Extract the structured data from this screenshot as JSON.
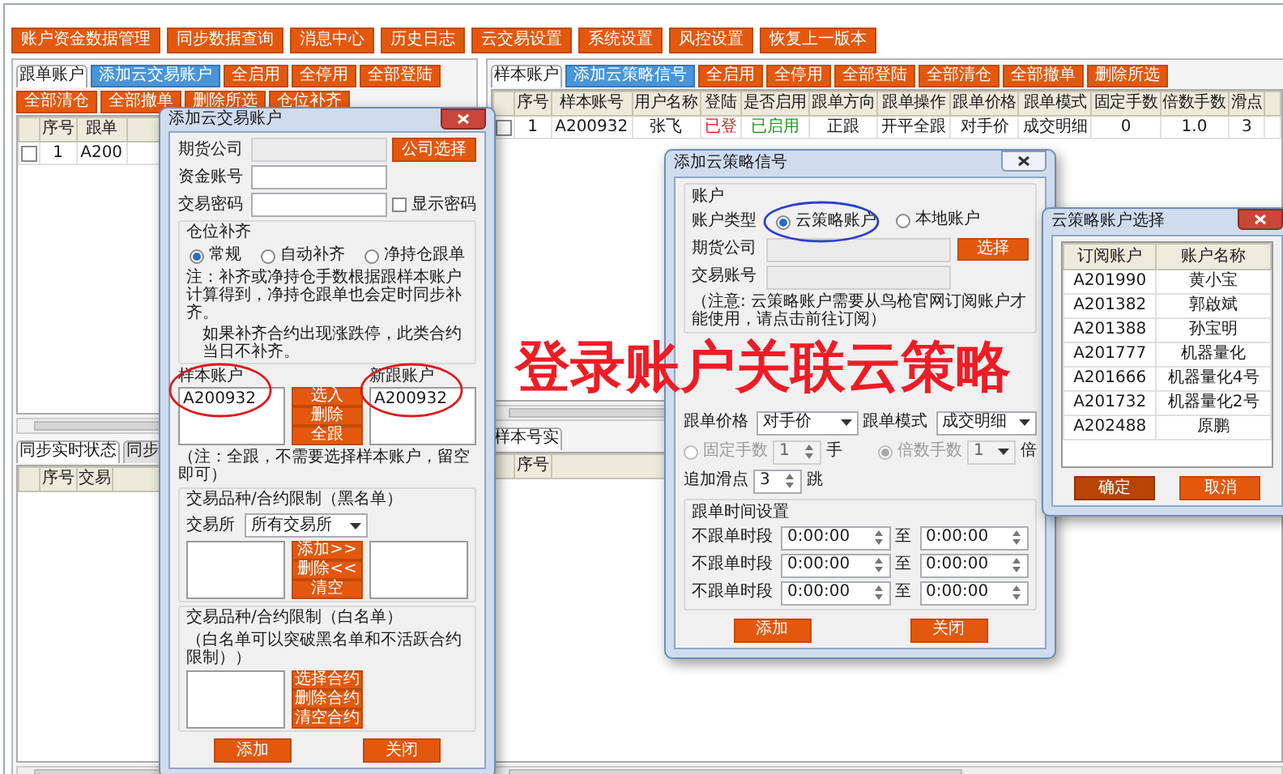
{
  "toolbar": {
    "buttons": [
      "账户资金数据管理",
      "同步数据查询",
      "消息中心",
      "历史日志",
      "云交易设置",
      "系统设置",
      "风控设置",
      "恢复上一版本"
    ]
  },
  "follow_pane": {
    "tabs": [
      {
        "label": "跟单账户",
        "selected": true
      }
    ],
    "actions": [
      {
        "label": "添加云交易账户",
        "kind": "primary"
      },
      {
        "label": "全启用",
        "kind": "action"
      },
      {
        "label": "全停用",
        "kind": "action"
      },
      {
        "label": "全部登陆",
        "kind": "action"
      },
      {
        "label": "全部清仓",
        "kind": "action"
      },
      {
        "label": "全部撤单",
        "kind": "action"
      },
      {
        "label": "删除所选",
        "kind": "action"
      },
      {
        "label": "仓位补齐",
        "kind": "action"
      }
    ],
    "table": {
      "columns": [
        "序号",
        "跟单"
      ],
      "rows": [
        {
          "checked": false,
          "cells": [
            "1",
            "A200"
          ]
        }
      ]
    },
    "bottom_tabs": [
      {
        "label": "同步实时状态",
        "selected": true
      },
      {
        "label": "同步",
        "selected": false
      }
    ],
    "bottom_table": {
      "columns": [
        "序号",
        "交易"
      ]
    }
  },
  "sample_pane": {
    "tabs": [
      {
        "label": "样本账户",
        "selected": true
      }
    ],
    "actions": [
      {
        "label": "添加云策略信号",
        "kind": "primary"
      },
      {
        "label": "全启用",
        "kind": "action"
      },
      {
        "label": "全停用",
        "kind": "action"
      },
      {
        "label": "全部登陆",
        "kind": "action"
      },
      {
        "label": "全部清仓",
        "kind": "action"
      },
      {
        "label": "全部撤单",
        "kind": "action"
      },
      {
        "label": "删除所选",
        "kind": "action"
      }
    ],
    "table": {
      "columns": [
        "序号",
        "样本账号",
        "用户名称",
        "登陆",
        "是否启用",
        "跟单方向",
        "跟单操作",
        "跟单价格",
        "跟单模式",
        "固定手数",
        "倍数手数",
        "滑点"
      ],
      "rows": [
        {
          "checked": false,
          "cells": [
            "1",
            "A200932",
            "张飞",
            {
              "text": "已登",
              "color": "#e02020"
            },
            {
              "text": "已启用",
              "color": "#1e9a1e"
            },
            "正跟",
            "开平全跟",
            "对手价",
            "成交明细",
            "0",
            "1.0",
            "3"
          ]
        }
      ]
    },
    "bottom_tabs": [
      {
        "label": "样本号实",
        "selected": true
      }
    ],
    "bottom_table": {
      "columns": [
        "序号"
      ]
    }
  },
  "account_dialog": {
    "title": "添加云交易账户",
    "fields": [
      {
        "label": "期货公司",
        "kind": "readonly"
      },
      {
        "label": "资金账号",
        "kind": "input"
      },
      {
        "label": "交易密码",
        "kind": "input"
      }
    ],
    "company_button": "公司选择",
    "show_password": {
      "label": "显示密码",
      "checked": false
    },
    "position_fill": {
      "title": "仓位补齐",
      "options": [
        {
          "label": "常规",
          "selected": true
        },
        {
          "label": "自动补齐",
          "selected": false
        },
        {
          "label": "净持仓跟单",
          "selected": false
        }
      ],
      "notes": [
        "注：补齐或净持仓手数根据跟样本账户计算得到，净持仓跟单也会定时同步补齐。",
        "如果补齐合约出现涨跌停，此类合约当日不补齐。"
      ]
    },
    "sample_list": {
      "title": "样本账户",
      "items": [
        "A200932"
      ],
      "circled": true
    },
    "list_buttons": [
      "选入",
      "删除",
      "全跟"
    ],
    "follow_list": {
      "title": "新跟账户",
      "items": [
        "A200932"
      ],
      "circled": true
    },
    "follow_note": "（注：全跟，不需要选择样本账户，留空即可）",
    "blacklist": {
      "title": "交易品种/合约限制（黑名单）",
      "exchange_label": "交易所",
      "exchange": "所有交易所",
      "buttons": [
        "添加>>",
        "删除<<",
        "清空"
      ]
    },
    "whitelist": {
      "title": "交易品种/合约限制（白名单）",
      "note": "（白名单可以突破黑名单和不活跃合约限制））",
      "buttons": [
        "选择合约",
        "删除合约",
        "清空合约"
      ]
    },
    "footer": [
      "添加",
      "关闭"
    ]
  },
  "signal_dialog": {
    "title": "添加云策略信号",
    "group": "账户",
    "account_type": {
      "label": "账户类型",
      "options": [
        {
          "label": "云策略账户",
          "selected": true,
          "circled": true
        },
        {
          "label": "本地账户",
          "selected": false,
          "circled": false
        }
      ]
    },
    "fields": [
      {
        "label": "期货公司",
        "button": "选择"
      },
      {
        "label": "交易账号"
      }
    ],
    "note": "（注意: 云策略账户需要从鸟枪官网订阅账户才能使用，请点击前往订阅）",
    "price": {
      "label": "跟单价格",
      "value": "对手价"
    },
    "mode": {
      "label": "跟单模式",
      "value": "成交明细"
    },
    "lots": [
      {
        "label": "固定手数",
        "selected": false,
        "disabled": true,
        "value": "1",
        "unit": "手",
        "kind": "spin"
      },
      {
        "label": "倍数手数",
        "selected": true,
        "disabled": true,
        "value": "1",
        "unit": "倍",
        "kind": "combo"
      }
    ],
    "slippage": {
      "label": "追加滑点",
      "value": "3",
      "unit": "跳"
    },
    "time_group": {
      "title": "跟单时间设置",
      "rows": [
        {
          "label": "不跟单时段",
          "from": "0:00:00",
          "sep": "至",
          "to": "0:00:00"
        },
        {
          "label": "不跟单时段",
          "from": "0:00:00",
          "sep": "至",
          "to": "0:00:00"
        },
        {
          "label": "不跟单时段",
          "from": "0:00:00",
          "sep": "至",
          "to": "0:00:00"
        }
      ]
    },
    "footer": [
      "添加",
      "关闭"
    ]
  },
  "select_dialog": {
    "title": "云策略账户选择",
    "columns": [
      "订阅账户",
      "账户名称"
    ],
    "rows": [
      [
        "A201990",
        "黄小宝"
      ],
      [
        "A201382",
        "郭啟斌"
      ],
      [
        "A201388",
        "孙宝明"
      ],
      [
        "A201777",
        "机器量化"
      ],
      [
        "A201666",
        "机器量化4号"
      ],
      [
        "A201732",
        "机器量化2号"
      ],
      [
        "A202488",
        "原鹏"
      ]
    ],
    "buttons": [
      {
        "label": "确定",
        "kind": "default"
      },
      {
        "label": "取消",
        "kind": "normal"
      }
    ]
  },
  "callout": {
    "text": "登录账户关联云策略"
  }
}
